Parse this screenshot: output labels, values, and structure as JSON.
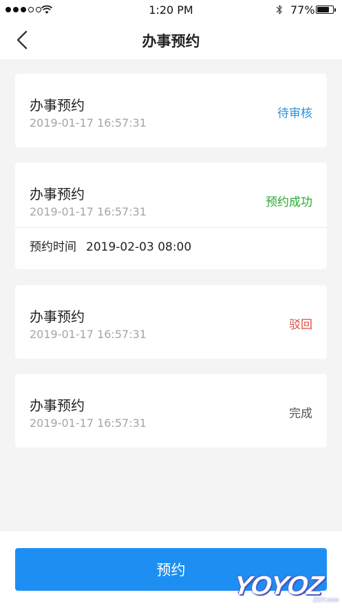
{
  "status_bar": {
    "time": "1:20 PM",
    "battery_percent": "77%",
    "battery_level": 0.77,
    "signal_bars_filled": 3,
    "signal_bars_total": 5
  },
  "nav": {
    "back_icon": "chevron-left-icon",
    "title": "办事预约"
  },
  "colors": {
    "pending": "#2b8fd9",
    "success": "#2aa935",
    "rejected": "#e04b3e",
    "completed": "#555555",
    "primary_button": "#1d8ff2"
  },
  "records": [
    {
      "title": "办事预约",
      "datetime": "2019-01-17 16:57:31",
      "status": "待审核"
    },
    {
      "title": "办事预约",
      "datetime": "2019-01-17 16:57:31",
      "status": "预约成功",
      "detail_label": "预约时间",
      "detail_value": "2019-02-03 08:00"
    },
    {
      "title": "办事预约",
      "datetime": "2019-01-17 16:57:31",
      "status": "驳回"
    },
    {
      "title": "办事预约",
      "datetime": "2019-01-17 16:57:31",
      "status": "完成"
    }
  ],
  "bottom": {
    "button_label": "预约"
  },
  "watermark": {
    "logo_text": "YOYOZ",
    "sub_text": "ZOY.com"
  }
}
